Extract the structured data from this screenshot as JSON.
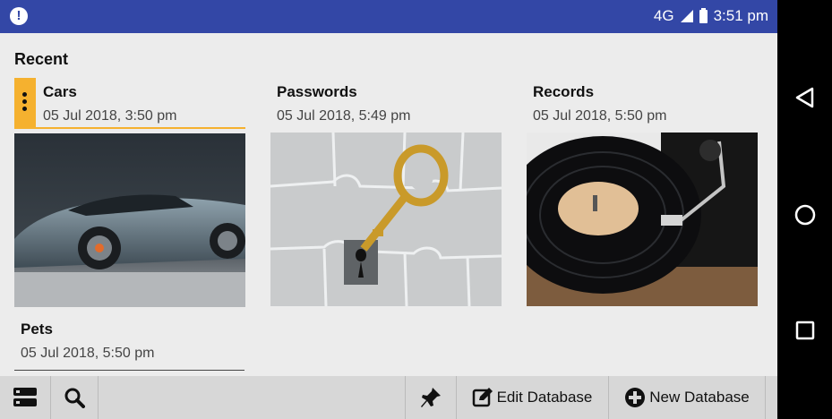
{
  "status": {
    "network": "4G",
    "time": "3:51 pm"
  },
  "recent": {
    "title": "Recent",
    "items": [
      {
        "title": "Cars",
        "date": "05 Jul 2018, 3:50 pm"
      },
      {
        "title": "Passwords",
        "date": "05 Jul 2018, 5:49 pm"
      },
      {
        "title": "Records",
        "date": "05 Jul 2018, 5:50 pm"
      },
      {
        "title": "Pets",
        "date": "05 Jul 2018, 5:50 pm"
      }
    ]
  },
  "toolbar": {
    "edit_label": "Edit Database",
    "new_label": "New Database"
  },
  "icons": {
    "alert": "alert-icon",
    "menu": "more-vert-icon",
    "list": "list-icon",
    "search": "search-icon",
    "pin": "pin-icon",
    "edit": "edit-icon",
    "add": "add-circle-icon",
    "back": "back-icon",
    "home": "home-icon",
    "recents": "recents-icon"
  },
  "colors": {
    "statusbar": "#3347a6",
    "selection": "#f5b12f",
    "background": "#ececec",
    "toolbar": "#d7d7d7"
  }
}
